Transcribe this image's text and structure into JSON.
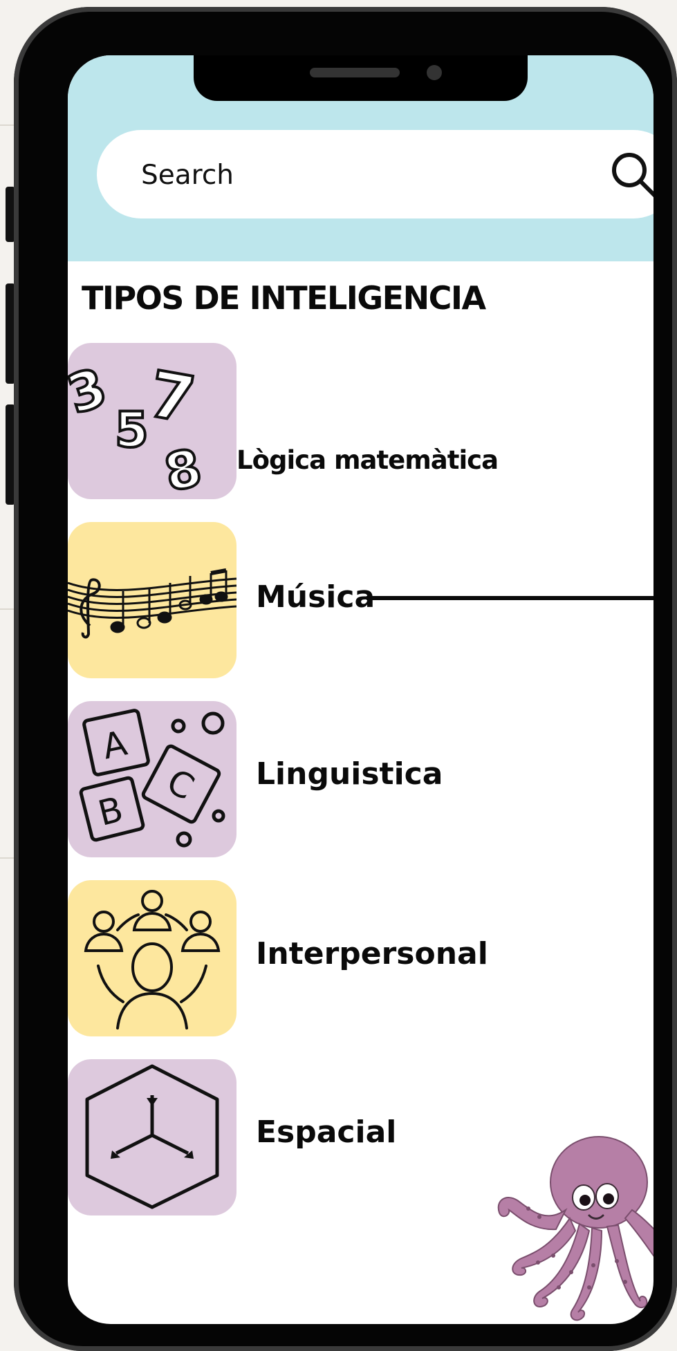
{
  "search": {
    "placeholder": "Search"
  },
  "section": {
    "title": "TIPOS DE INTELIGENCIA"
  },
  "items": [
    {
      "label": "Lògica matemàtica",
      "icon": "numbers-icon",
      "color": "#ddc9dd"
    },
    {
      "label": "Música",
      "icon": "music-notes-icon",
      "color": "#fde79e"
    },
    {
      "label": "Linguistica",
      "icon": "abc-blocks-icon",
      "color": "#ddc9dd"
    },
    {
      "label": "Interpersonal",
      "icon": "people-group-icon",
      "color": "#fde79e"
    },
    {
      "label": "Espacial",
      "icon": "cube-icon",
      "color": "#ddc9dd"
    }
  ],
  "theme": {
    "header": "#bde6ec",
    "pink": "#ddc9dd",
    "yellow": "#fde79e",
    "octopus": "#b67fa6"
  }
}
